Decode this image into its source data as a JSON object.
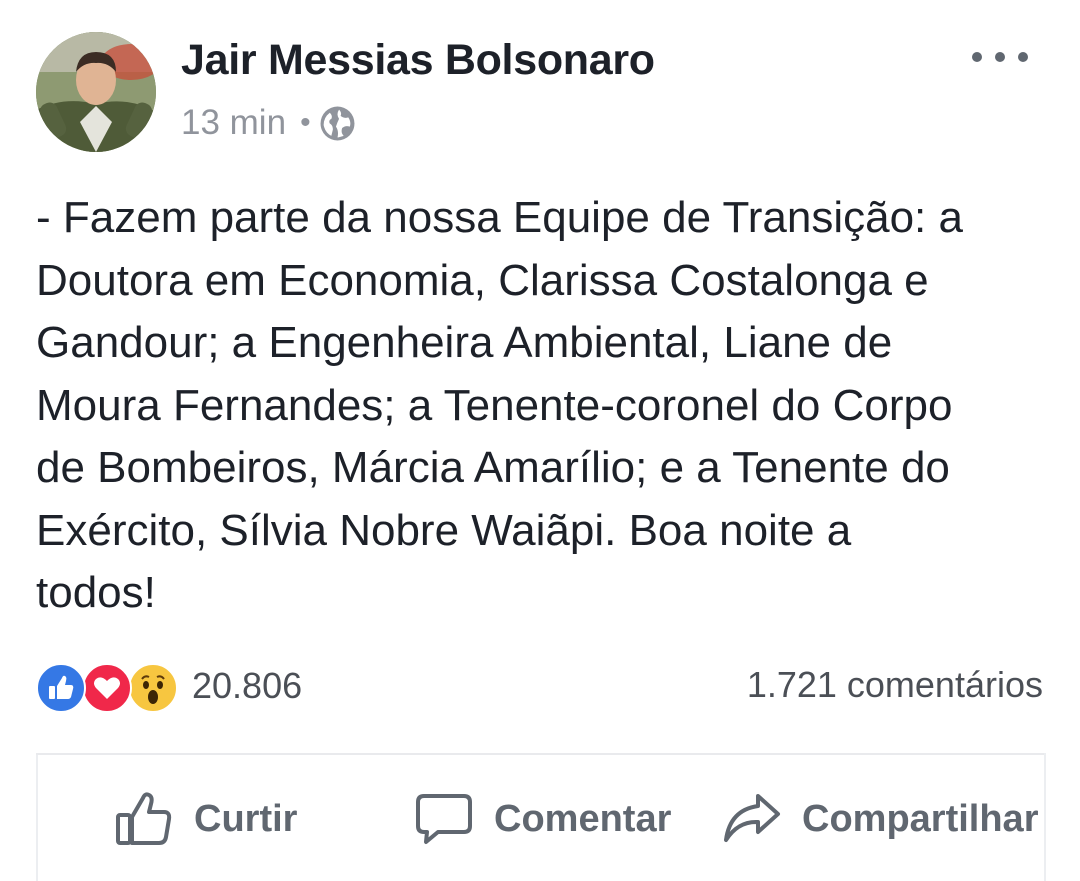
{
  "post": {
    "author": "Jair Messias Bolsonaro",
    "time": "13 min",
    "separator": "•",
    "audience_icon": "globe-icon",
    "menu_icon": "more-options-icon",
    "text_lines": [
      "- Fazem parte da nossa Equipe de Transição: a",
      "Doutora em Economia, Clarissa Costalonga e",
      "Gandour; a Engenheira Ambiental, Liane de",
      "Moura Fernandes; a Tenente-coronel do Corpo",
      "de Bombeiros, Márcia Amarílio; e a Tenente do",
      "Exército, Sílvia Nobre Waiãpi. Boa noite a",
      "todos!"
    ]
  },
  "reactions": {
    "icons": [
      "like-reaction-icon",
      "love-reaction-icon",
      "wow-reaction-icon"
    ],
    "count": "20.806"
  },
  "comments": {
    "count_label": "1.721 comentários"
  },
  "actions": {
    "like_label": "Curtir",
    "comment_label": "Comentar",
    "share_label": "Compartilhar"
  },
  "colors": {
    "like_blue": "#3578e5",
    "love_red": "#f0284a",
    "wow_yellow": "#f7c640",
    "muted_text": "#90949c",
    "action_gray": "#606770"
  }
}
